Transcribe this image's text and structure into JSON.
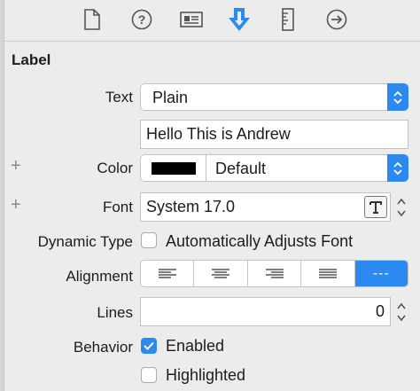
{
  "toolbar": {
    "icons": [
      "file-icon",
      "help-icon",
      "identity-icon",
      "attributes-icon",
      "size-icon",
      "connections-icon"
    ],
    "active": "attributes-icon",
    "accent": "#2c89f0"
  },
  "section": {
    "title": "Label"
  },
  "text_row": {
    "label": "Text",
    "type_value": "Plain",
    "content_value": "Hello This is Andrew"
  },
  "color_row": {
    "label": "Color",
    "swatch": "#000000",
    "value": "Default"
  },
  "font_row": {
    "label": "Font",
    "value": "System 17.0"
  },
  "dynamic_type_row": {
    "label": "Dynamic Type",
    "checkbox_label": "Automatically Adjusts Font",
    "checked": false
  },
  "alignment_row": {
    "label": "Alignment",
    "options": [
      "left",
      "center",
      "right",
      "justified",
      "natural"
    ],
    "selected": "natural",
    "natural_glyph": "---"
  },
  "lines_row": {
    "label": "Lines",
    "value": "0"
  },
  "behavior_row": {
    "label": "Behavior",
    "enabled_label": "Enabled",
    "enabled_checked": true,
    "highlighted_label": "Highlighted",
    "highlighted_checked": false
  }
}
